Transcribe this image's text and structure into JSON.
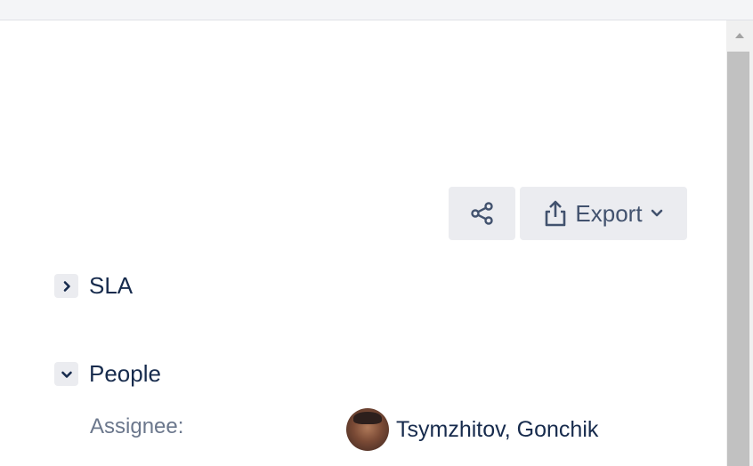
{
  "toolbar": {
    "share_icon": "share-icon",
    "export_label": "Export",
    "export_icon": "upload-icon"
  },
  "sections": {
    "sla": {
      "title": "SLA",
      "expanded": false
    },
    "people": {
      "title": "People",
      "expanded": true
    }
  },
  "people": {
    "assignee_label": "Assignee:",
    "assignee_name": "Tsymzhitov, Gonchik"
  },
  "colors": {
    "button_bg": "#ebecf0",
    "text": "#172b4d",
    "muted": "#6b778c"
  }
}
